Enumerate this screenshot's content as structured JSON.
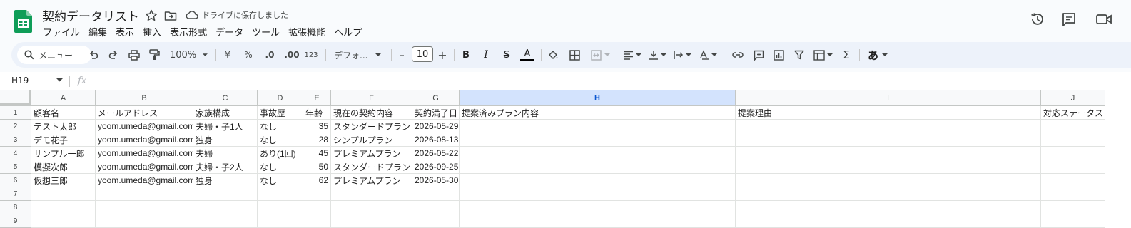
{
  "doc": {
    "title": "契約データリスト",
    "save_status": "ドライブに保存しました"
  },
  "menu": [
    "ファイル",
    "編集",
    "表示",
    "挿入",
    "表示形式",
    "データ",
    "ツール",
    "拡張機能",
    "ヘルプ"
  ],
  "toolbar": {
    "search_label": "メニュー",
    "zoom": "100%",
    "currency": "¥",
    "percent": "%",
    "dec_decrease": ".0",
    "dec_increase": ".00",
    "number_format": "123",
    "font": "デフォ...",
    "font_size": "10",
    "minus": "–",
    "plus": "+",
    "bold": "B",
    "italic": "I",
    "strike": "S",
    "text_color_letter": "A",
    "input_tools": "あ",
    "sum": "Σ",
    "text_color": "#000000"
  },
  "formula_bar": {
    "name_box": "H19",
    "fx": "fx"
  },
  "sheet": {
    "columns": [
      "A",
      "B",
      "C",
      "D",
      "E",
      "F",
      "G",
      "H",
      "I",
      "J"
    ],
    "selected_column": "H",
    "rows": [
      [
        "顧客名",
        "メールアドレス",
        "家族構成",
        "事故歴",
        "年齢",
        "現在の契約内容",
        "契約満了日",
        "提案済みプラン内容",
        "提案理由",
        "対応ステータス"
      ],
      [
        "テスト太郎",
        "yoom.umeda@gmail.com",
        "夫婦・子1人",
        "なし",
        "35",
        "スタンダードプラン",
        "2026-05-29",
        "",
        "",
        ""
      ],
      [
        "デモ花子",
        "yoom.umeda@gmail.com",
        "独身",
        "なし",
        "28",
        "シンプルプラン",
        "2026-08-13",
        "",
        "",
        ""
      ],
      [
        "サンプル一郎",
        "yoom.umeda@gmail.com",
        "夫婦",
        "あり(1回)",
        "45",
        "プレミアムプラン",
        "2026-05-22",
        "",
        "",
        ""
      ],
      [
        "模擬次郎",
        "yoom.umeda@gmail.com",
        "夫婦・子2人",
        "なし",
        "50",
        "スタンダードプラン",
        "2026-09-25",
        "",
        "",
        ""
      ],
      [
        "仮想三郎",
        "yoom.umeda@gmail.com",
        "独身",
        "なし",
        "62",
        "プレミアムプラン",
        "2026-05-30",
        "",
        "",
        ""
      ],
      [
        "",
        "",
        "",
        "",
        "",
        "",
        "",
        "",
        "",
        ""
      ],
      [
        "",
        "",
        "",
        "",
        "",
        "",
        "",
        "",
        "",
        ""
      ],
      [
        "",
        "",
        "",
        "",
        "",
        "",
        "",
        "",
        "",
        ""
      ]
    ],
    "row_numbers": [
      "1",
      "2",
      "3",
      "4",
      "5",
      "6",
      "7",
      "8",
      "9"
    ]
  }
}
